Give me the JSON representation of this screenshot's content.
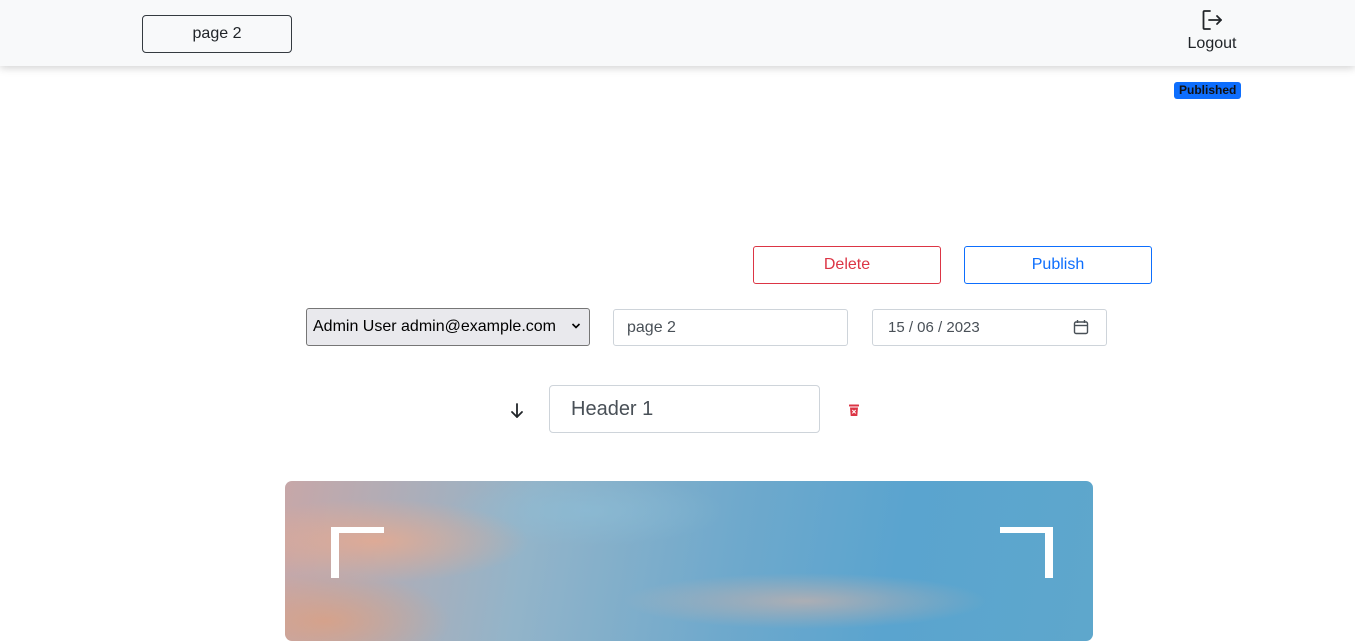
{
  "topbar": {
    "page_button_label": "page 2",
    "logout_label": "Logout",
    "logout_icon": "logout-icon"
  },
  "status_badge": "Published",
  "actions": {
    "delete_label": "Delete",
    "publish_label": "Publish"
  },
  "form": {
    "author_select_value": "Admin User admin@example.com",
    "title_input_value": "page 2",
    "date_input_value": "15 / 06 / 2023"
  },
  "section": {
    "header_input_value": "Header 1",
    "move_icon": "arrow-down-icon",
    "delete_icon": "trash-icon"
  },
  "colors": {
    "danger": "#dc3545",
    "primary": "#0d6efd",
    "topbar_bg": "#f8f9fa"
  }
}
